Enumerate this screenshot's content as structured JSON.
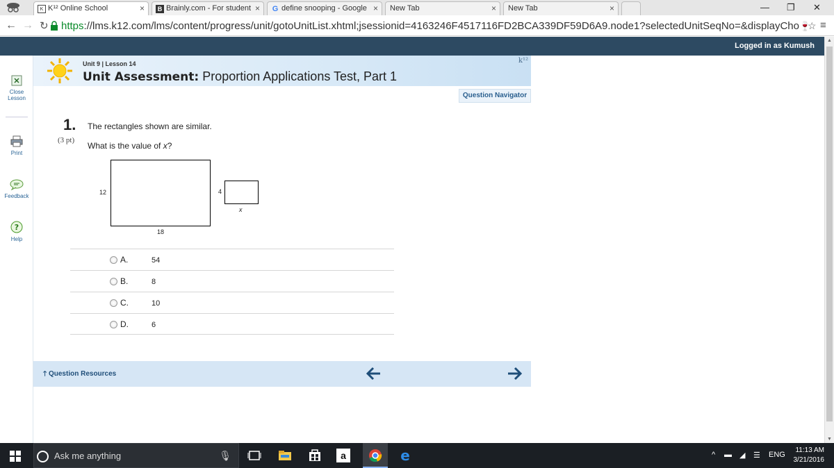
{
  "browser": {
    "tabs": [
      {
        "title": "K¹² Online School",
        "active": true
      },
      {
        "title": "Brainly.com - For student",
        "active": false
      },
      {
        "title": "define snooping - Google",
        "active": false
      },
      {
        "title": "New Tab",
        "active": false
      },
      {
        "title": "New Tab",
        "active": false
      }
    ],
    "url_scheme": "https",
    "url_rest": "://lms.k12.com/lms/content/progress/unit/gotoUnitList.xhtml;jsessionid=4163246F4517116FD2BCA339DF59D6A9.node1?selectedUnitSeqNo=&displayChoosable"
  },
  "header": {
    "logged_in": "Logged in as Kumush"
  },
  "sidebar": {
    "items": [
      {
        "label_line1": "Close",
        "label_line2": "Lesson",
        "icon": "close-icon"
      },
      {
        "label_line1": "Print",
        "label_line2": "",
        "icon": "printer-icon"
      },
      {
        "label_line1": "Feedback",
        "label_line2": "",
        "icon": "feedback-icon"
      },
      {
        "label_line1": "Help",
        "label_line2": "",
        "icon": "help-icon"
      }
    ]
  },
  "lesson": {
    "unit_line": "Unit 9 | Lesson 14",
    "title_bold": "Unit Assessment:",
    "title_rest": " Proportion Applications Test, Part 1",
    "logo_mark": "k¹²",
    "question_navigator": "Question Navigator"
  },
  "question": {
    "number": "1.",
    "points": "(3 pt)",
    "text1": "The rectangles shown are similar.",
    "text2_prefix": "What is the value of ",
    "text2_var": "x",
    "text2_suffix": "?",
    "big_rect": {
      "height_label": "12",
      "width_label": "18"
    },
    "small_rect": {
      "height_label": "4",
      "width_label": "x"
    },
    "choices": [
      {
        "letter": "A.",
        "value": "54"
      },
      {
        "letter": "B.",
        "value": "8"
      },
      {
        "letter": "C.",
        "value": "10"
      },
      {
        "letter": "D.",
        "value": "6"
      }
    ]
  },
  "footer": {
    "resources": "Question Resources"
  },
  "taskbar": {
    "search_placeholder": "Ask me anything",
    "lang": "ENG",
    "time": "11:13 AM",
    "date": "3/21/2016"
  }
}
